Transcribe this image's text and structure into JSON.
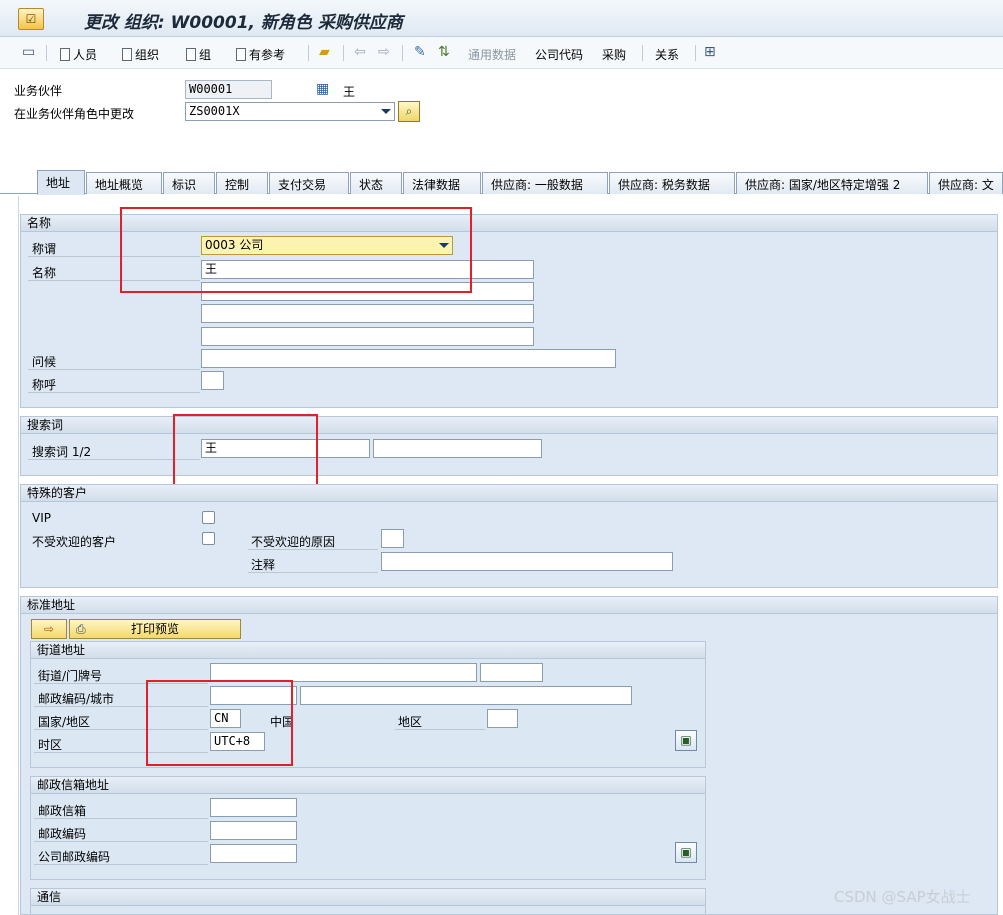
{
  "window": {
    "title": "更改 组织: W00001, 新角色 采购供应商"
  },
  "toolbar": {
    "person_label": "人员",
    "org_label": "组织",
    "group_label": "组",
    "with_ref_label": "有参考",
    "general_data_label": "通用数据",
    "company_code_label": "公司代码",
    "purchasing_label": "采购",
    "relations_label": "关系"
  },
  "header": {
    "bp_label": "业务伙伴",
    "bp_value": "W00001",
    "bp_name": "王",
    "role_label": "在业务伙伴角色中更改",
    "role_value": "ZS0001X"
  },
  "tabs": [
    {
      "label": "地址"
    },
    {
      "label": "地址概览"
    },
    {
      "label": "标识"
    },
    {
      "label": "控制"
    },
    {
      "label": "支付交易"
    },
    {
      "label": "状态"
    },
    {
      "label": "法律数据"
    },
    {
      "label": "供应商: 一般数据"
    },
    {
      "label": "供应商: 税务数据"
    },
    {
      "label": "供应商: 国家/地区特定增强 2"
    },
    {
      "label": "供应商: 文"
    }
  ],
  "name_group": {
    "title": "名称",
    "salutation_label": "称谓",
    "salutation_value": "0003 公司",
    "name_label": "名称",
    "name1": "王",
    "name2": "",
    "name3": "",
    "name4": "",
    "greeting_label": "问候",
    "greeting_value": "",
    "address_form_label": "称呼",
    "address_form_value": ""
  },
  "search_group": {
    "title": "搜索词",
    "search_label": "搜索词 1/2",
    "search1": "王",
    "search2": ""
  },
  "special_group": {
    "title": "特殊的客户",
    "vip_label": "VIP",
    "unwanted_label": "不受欢迎的客户",
    "unwanted_reason_label": "不受欢迎的原因",
    "unwanted_reason_value": "",
    "note_label": "注释",
    "note_value": ""
  },
  "std_address_group": {
    "title": "标准地址",
    "print_preview_label": "打印预览",
    "street_section": {
      "title": "街道地址",
      "street_label": "街道/门牌号",
      "street_value": "",
      "house_no": "",
      "postal_city_label": "邮政编码/城市",
      "postal_code": "",
      "city": "",
      "country_label": "国家/地区",
      "country_code": "CN",
      "country_name": "中国",
      "region_label": "地区",
      "region_value": "",
      "timezone_label": "时区",
      "timezone_value": "UTC+8"
    },
    "po_box_section": {
      "title": "邮政信箱地址",
      "po_box_label": "邮政信箱",
      "po_box_value": "",
      "postal_code_label": "邮政编码",
      "postal_code_value": "",
      "company_postal_label": "公司邮政编码",
      "company_postal_value": ""
    },
    "comm_section": {
      "title": "通信"
    }
  },
  "watermark": "CSDN @SAP女战士"
}
